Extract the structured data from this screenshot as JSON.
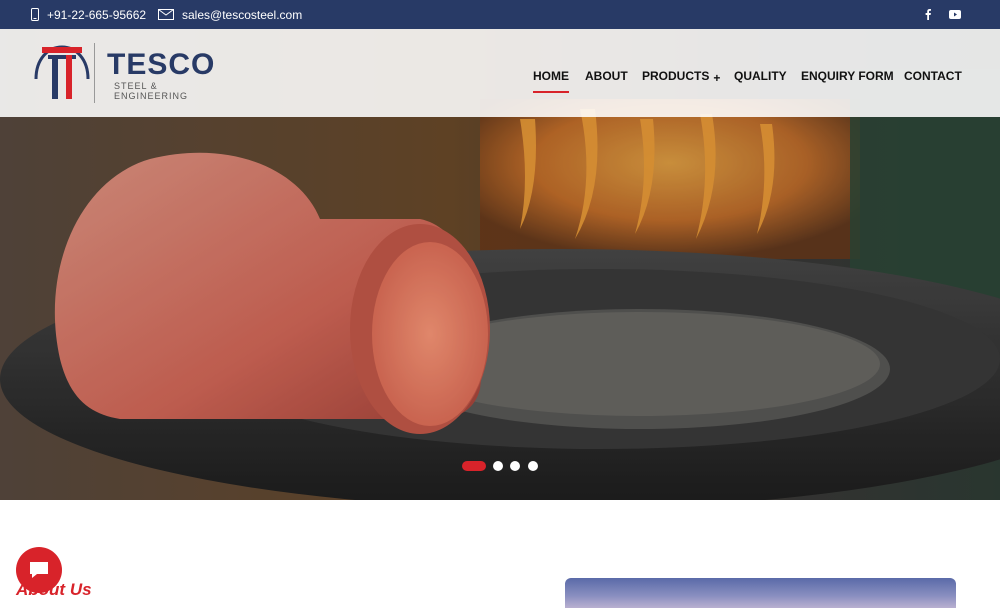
{
  "topbar": {
    "phone": "+91-22-665-95662",
    "email": "sales@tescosteel.com",
    "icons": {
      "phone": "mobile-phone-icon",
      "email": "envelope-icon",
      "facebook": "facebook-icon",
      "youtube": "youtube-icon"
    }
  },
  "brand": {
    "name": "TESCO",
    "tagline": "STEEL & ENGINEERING",
    "colors": {
      "navy": "#283a66",
      "red": "#d8232a"
    }
  },
  "nav": {
    "items": [
      {
        "label": "HOME",
        "active": true
      },
      {
        "label": "ABOUT",
        "active": false
      },
      {
        "label": "PRODUCTS",
        "active": false,
        "expand": "+"
      },
      {
        "label": "QUALITY",
        "active": false
      },
      {
        "label": "ENQUIRY FORM",
        "active": false
      },
      {
        "label": "CONTACT",
        "active": false
      }
    ]
  },
  "slider": {
    "slides": 4,
    "current": 1
  },
  "about": {
    "title": "About Us"
  }
}
